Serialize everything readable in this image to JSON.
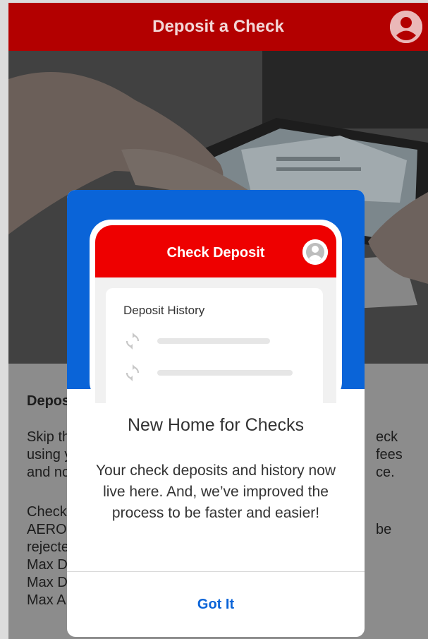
{
  "header": {
    "title": "Deposit a Check",
    "avatar_icon": "account-circle-icon",
    "bar_color": "#b30000"
  },
  "content": {
    "heading": "Depos",
    "lines_1": [
      "Skip th",
      "using y",
      "and no"
    ],
    "lines_1_right": [
      "eck",
      "fees",
      "ce."
    ],
    "lines_2": [
      "Checks",
      "AEROC",
      "rejecte",
      "Max Da",
      "Max De",
      "Max Ar"
    ],
    "lines_2_right": [
      "be"
    ]
  },
  "modal": {
    "phone_title": "Check Deposit",
    "phone_avatar_icon": "account-circle-icon",
    "history_title": "Deposit History",
    "history_icon": "sync-icon",
    "title": "New Home for Checks",
    "message": "Your check deposits and history now live here. And, we’ve improved the process to be faster and easier!",
    "button_label": "Got It",
    "accent_color": "#0a64d8",
    "phone_header_color": "#ee0000"
  }
}
